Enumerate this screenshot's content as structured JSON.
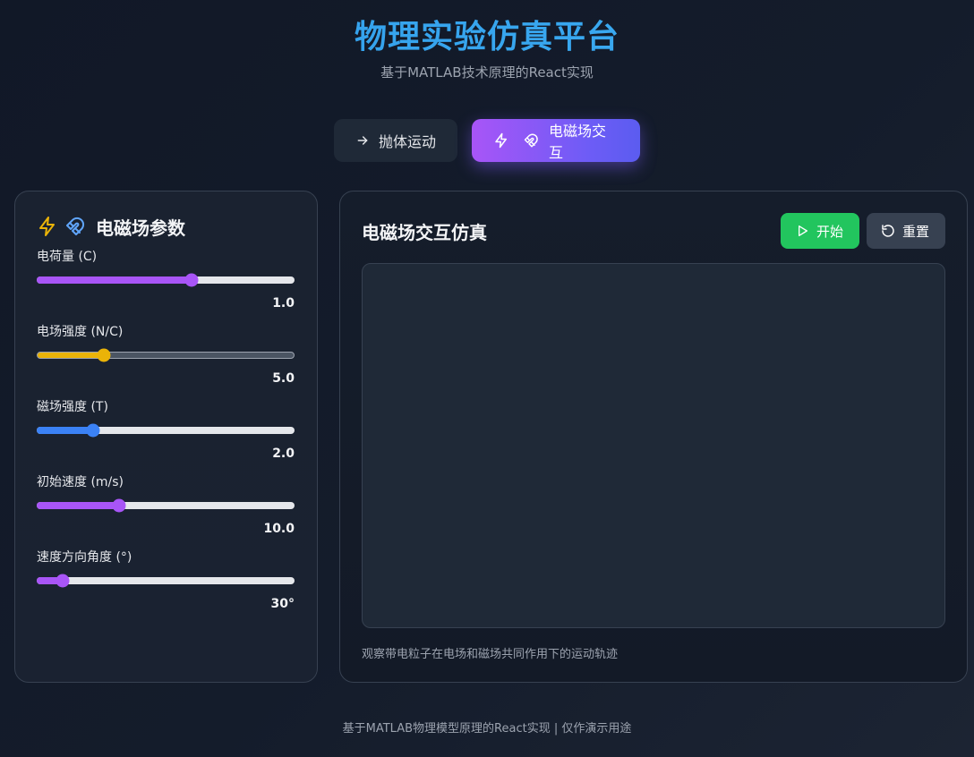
{
  "header": {
    "title": "物理实验仿真平台",
    "subtitle": "基于MATLAB技术原理的React实现"
  },
  "tabs": [
    {
      "label": "抛体运动",
      "icon": "arrow-right-icon",
      "active": false
    },
    {
      "label": "电磁场交互",
      "icon": "magnet-icon",
      "active": true
    }
  ],
  "params": {
    "title": "电磁场参数",
    "icons": [
      "lightning-icon",
      "magnet-icon"
    ],
    "items": [
      {
        "label": "电荷量 (C)",
        "value": "1.0",
        "fraction": 0.6,
        "color": "#a855f7"
      },
      {
        "label": "电场强度 (N/C)",
        "value": "5.0",
        "fraction": 0.26,
        "color": "#eab308"
      },
      {
        "label": "磁场强度 (T)",
        "value": "2.0",
        "fraction": 0.22,
        "color": "#3b82f6"
      },
      {
        "label": "初始速度 (m/s)",
        "value": "10.0",
        "fraction": 0.32,
        "color": "#a855f7"
      },
      {
        "label": "速度方向角度 (°)",
        "value": "30°",
        "fraction": 0.1,
        "color": "#a855f7"
      }
    ]
  },
  "sim": {
    "title": "电磁场交互仿真",
    "start_label": "开始",
    "reset_label": "重置",
    "caption": "观察带电粒子在电场和磁场共同作用下的运动轨迹"
  },
  "colors": {
    "accent_blue": "#38a3f1",
    "accent_purple": "#a855f7",
    "start_green": "#22c55e",
    "lightning_yellow": "#eab308"
  },
  "footer": "基于MATLAB物理模型原理的React实现 | 仅作演示用途"
}
